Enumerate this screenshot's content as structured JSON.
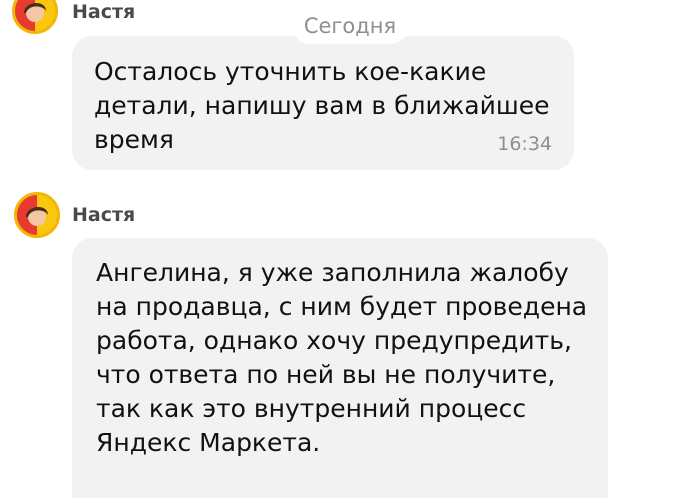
{
  "chat": {
    "date_separator": "Сегодня",
    "messages": [
      {
        "sender": "Настя",
        "lines": [
          "Осталось уточнить кое-какие",
          "детали, напишу вам в ближайшее",
          "время"
        ],
        "time": "16:34"
      },
      {
        "sender": "Настя",
        "lines": [
          "Ангелина, я уже заполнила жалобу",
          "на продавца, с ним будет проведена",
          "работа, однако хочу предупредить,",
          "что ответа по ней вы не получите,",
          "так как это внутренний процесс",
          "Яндекс Маркета."
        ]
      }
    ]
  },
  "colors": {
    "bubble_background": "#f2f2f3",
    "avatar_ring": "#f2b705",
    "avatar_left": "#f9c80e",
    "avatar_right": "#e63b2e",
    "meta_text": "#8f8f8f"
  },
  "icons": {
    "avatar": "operator-avatar-icon"
  }
}
